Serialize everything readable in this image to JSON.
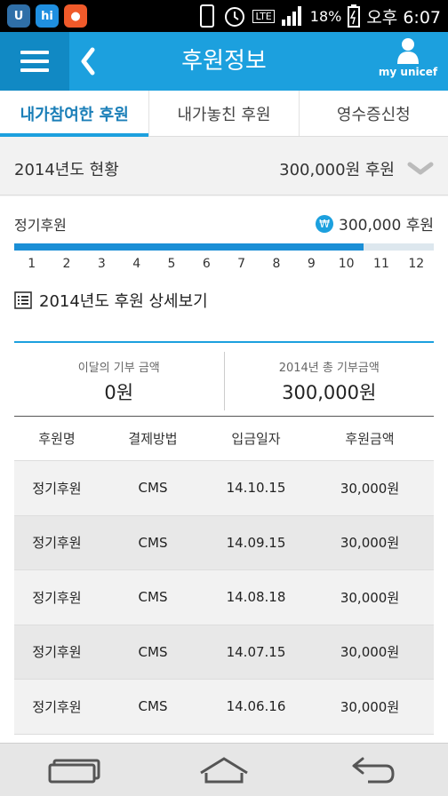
{
  "status": {
    "apps": [
      {
        "label": "U",
        "color": "#2f6fa8"
      },
      {
        "label": "hi",
        "color": "#1f8fe0"
      },
      {
        "label": "●",
        "color": "#f05a2a"
      }
    ],
    "lte": "LTE",
    "battery": "18%",
    "time": "오후 6:07"
  },
  "appbar": {
    "title": "후원정보",
    "profile_label": "my unicef",
    "color": "#1ca0de"
  },
  "tabs": [
    {
      "label": "내가참여한 후원",
      "active": true
    },
    {
      "label": "내가놓친 후원",
      "active": false
    },
    {
      "label": "영수증신청",
      "active": false
    }
  ],
  "year_summary": {
    "label": "2014년도 현황",
    "amount": "300,000원 후원"
  },
  "regular": {
    "label": "정기후원",
    "won_symbol": "₩",
    "amount": "300,000 후원",
    "progress_fraction": 0.833,
    "months": [
      "1",
      "2",
      "3",
      "4",
      "5",
      "6",
      "7",
      "8",
      "9",
      "10",
      "11",
      "12"
    ]
  },
  "detail": {
    "label": "2014년도 후원 상세보기"
  },
  "totals": {
    "this_month_label": "이달의 기부 금액",
    "this_month_value": "0원",
    "year_label": "2014년 총 기부금액",
    "year_value": "300,000원"
  },
  "table": {
    "headers": [
      "후원명",
      "결제방법",
      "입금일자",
      "후원금액"
    ],
    "rows": [
      [
        "정기후원",
        "CMS",
        "14.10.15",
        "30,000원"
      ],
      [
        "정기후원",
        "CMS",
        "14.09.15",
        "30,000원"
      ],
      [
        "정기후원",
        "CMS",
        "14.08.18",
        "30,000원"
      ],
      [
        "정기후원",
        "CMS",
        "14.07.15",
        "30,000원"
      ],
      [
        "정기후원",
        "CMS",
        "14.06.16",
        "30,000원"
      ]
    ]
  }
}
